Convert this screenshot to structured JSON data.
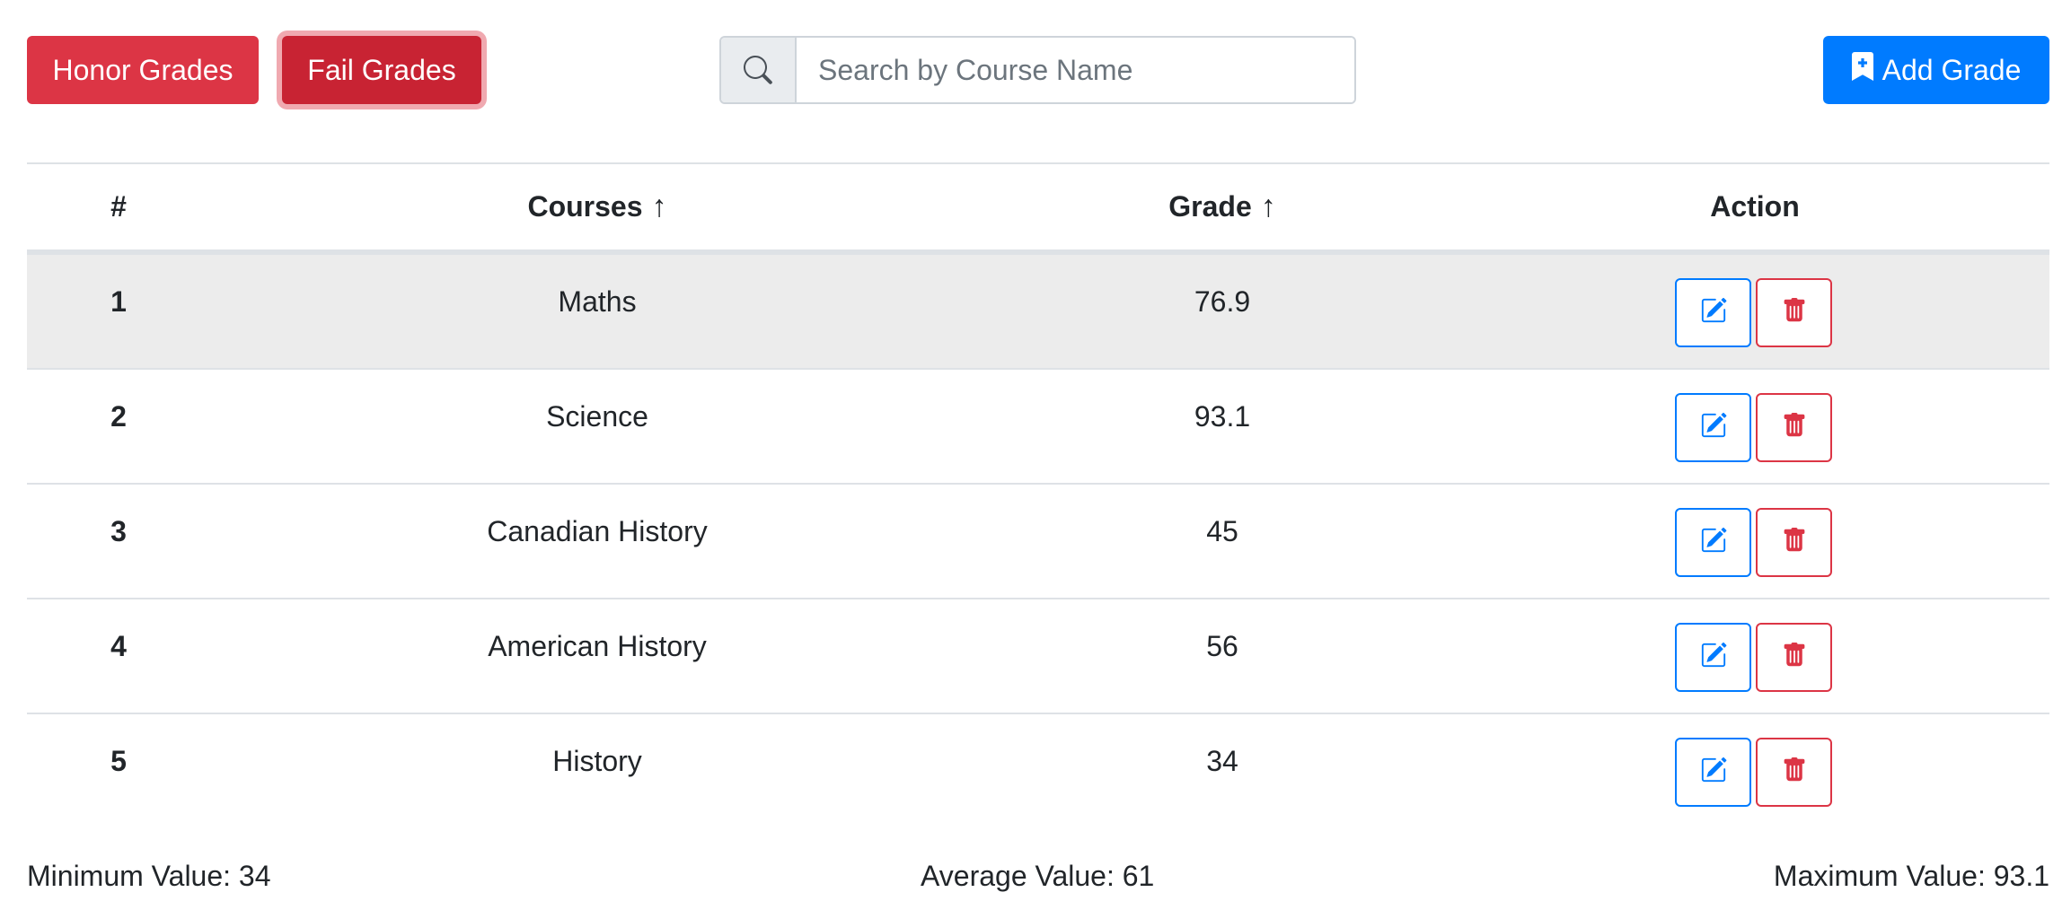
{
  "toolbar": {
    "honor_label": "Honor Grades",
    "fail_label": "Fail Grades",
    "add_label": "Add Grade",
    "search_placeholder": "Search by Course Name",
    "search_value": ""
  },
  "table": {
    "headers": {
      "num": "#",
      "courses": "Courses",
      "grade": "Grade",
      "action": "Action",
      "sort_arrow": "↑"
    },
    "rows": [
      {
        "num": "1",
        "course": "Maths",
        "grade": "76.9"
      },
      {
        "num": "2",
        "course": "Science",
        "grade": "93.1"
      },
      {
        "num": "3",
        "course": "Canadian History",
        "grade": "45"
      },
      {
        "num": "4",
        "course": "American History",
        "grade": "56"
      },
      {
        "num": "5",
        "course": "History",
        "grade": "34"
      }
    ]
  },
  "stats": {
    "min": "Minimum Value: 34",
    "avg": "Average Value: 61",
    "max": "Maximum Value: 93.1"
  },
  "colors": {
    "danger": "#dc3545",
    "danger_active": "#c82333",
    "primary": "#007bff",
    "row_highlight": "#ececec"
  },
  "icons": {
    "search": "search-icon",
    "add": "bookmark-plus-icon",
    "edit": "pencil-square-icon",
    "delete": "trash-icon",
    "sort": "arrow-up-icon"
  }
}
